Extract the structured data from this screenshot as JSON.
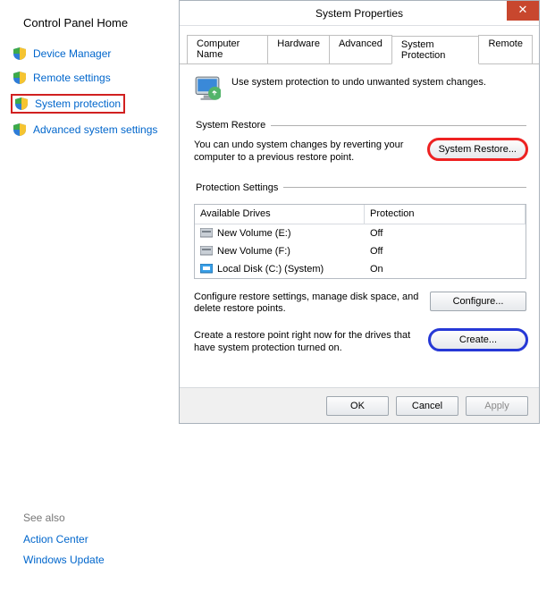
{
  "left_panel": {
    "home": "Control Panel Home",
    "links": [
      {
        "key": "device-manager",
        "label": "Device Manager",
        "highlight": false
      },
      {
        "key": "remote-settings",
        "label": "Remote settings",
        "highlight": false
      },
      {
        "key": "system-protection",
        "label": "System protection",
        "highlight": true
      },
      {
        "key": "advanced-settings",
        "label": "Advanced system settings",
        "highlight": false
      }
    ],
    "see_also": {
      "heading": "See also",
      "links": [
        "Action Center",
        "Windows Update"
      ]
    }
  },
  "dialog": {
    "title": "System Properties",
    "close_glyph": "✕",
    "tabs": [
      {
        "key": "computer-name",
        "label": "Computer Name"
      },
      {
        "key": "hardware",
        "label": "Hardware"
      },
      {
        "key": "advanced",
        "label": "Advanced"
      },
      {
        "key": "system-protection",
        "label": "System Protection",
        "active": true
      },
      {
        "key": "remote",
        "label": "Remote"
      }
    ],
    "intro": "Use system protection to undo unwanted system changes.",
    "restore": {
      "legend": "System Restore",
      "desc": "You can undo system changes by reverting your computer to a previous restore point.",
      "button": "System Restore..."
    },
    "protection": {
      "legend": "Protection Settings",
      "col_drive": "Available Drives",
      "col_prot": "Protection",
      "drives": [
        {
          "name": "New Volume (E:)",
          "protection": "Off",
          "icon": "hdd"
        },
        {
          "name": "New Volume (F:)",
          "protection": "Off",
          "icon": "hdd"
        },
        {
          "name": "Local Disk (C:) (System)",
          "protection": "On",
          "icon": "sys"
        }
      ],
      "configure_desc": "Configure restore settings, manage disk space, and delete restore points.",
      "configure_btn": "Configure...",
      "create_desc": "Create a restore point right now for the drives that have system protection turned on.",
      "create_btn": "Create..."
    },
    "buttons": {
      "ok": "OK",
      "cancel": "Cancel",
      "apply": "Apply"
    }
  }
}
